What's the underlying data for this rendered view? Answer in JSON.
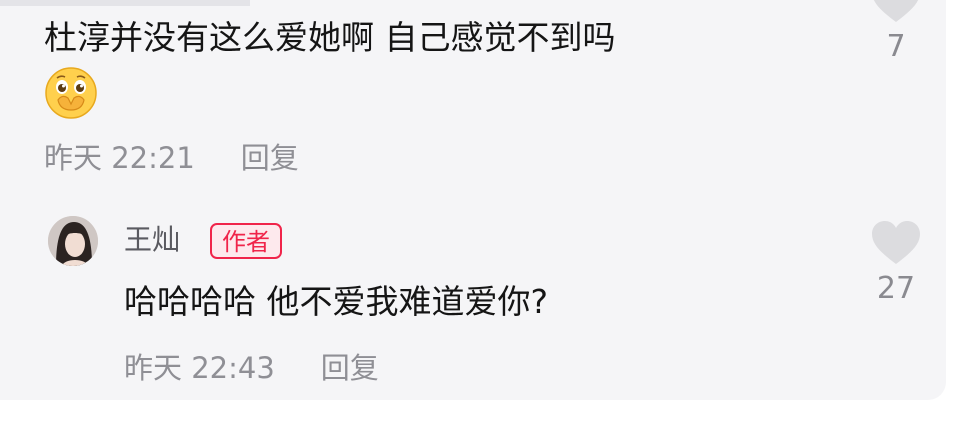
{
  "comment1": {
    "text": "杜淳并没有这么爱她啊 自己感觉不到吗",
    "emoji": "covering-mouth-emoji",
    "time": "昨天 22:21",
    "reply_label": "回复",
    "likes": "7"
  },
  "comment2": {
    "username": "王灿",
    "badge": "作者",
    "text": "哈哈哈哈 他不爱我难道爱你?",
    "time": "昨天 22:43",
    "reply_label": "回复",
    "likes": "27"
  },
  "colors": {
    "badge_red": "#f0244a",
    "meta_gray": "#8f8f95",
    "card_bg": "#f5f5f7"
  }
}
